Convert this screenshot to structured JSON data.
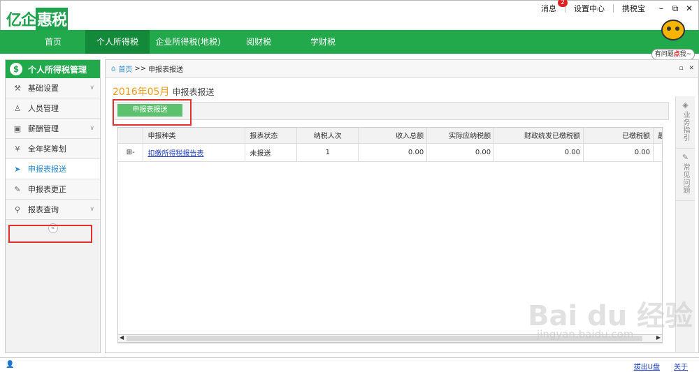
{
  "app": {
    "logo_prefix": "亿企",
    "logo_box": "惠税"
  },
  "topnav": {
    "messages": "消息",
    "messages_badge": "2",
    "settings": "设置中心",
    "taxbao": "携税宝"
  },
  "mainnav": {
    "tabs": [
      {
        "label": "首页"
      },
      {
        "label": "个人所得税"
      },
      {
        "label": "企业所得税(地税)"
      },
      {
        "label": "阅财税"
      },
      {
        "label": "学财税"
      }
    ]
  },
  "mascot": {
    "bubble_prefix": "有问题",
    "bubble_highlight": "点",
    "bubble_suffix": "我~"
  },
  "sidebar": {
    "title": "个人所得税管理",
    "items": [
      {
        "label": "基础设置",
        "icon": "wrench-icon",
        "expandable": true
      },
      {
        "label": "人员管理",
        "icon": "person-icon",
        "expandable": false
      },
      {
        "label": "薪酬管理",
        "icon": "salary-icon",
        "expandable": true
      },
      {
        "label": "全年奖筹划",
        "icon": "bonus-icon",
        "expandable": false
      },
      {
        "label": "申报表报送",
        "icon": "send-icon",
        "expandable": false,
        "active": true
      },
      {
        "label": "申报表更正",
        "icon": "edit-icon",
        "expandable": false
      },
      {
        "label": "报表查询",
        "icon": "search-icon",
        "expandable": true
      }
    ]
  },
  "breadcrumb": {
    "home": "首页",
    "separator": ">>",
    "current": "申报表报送"
  },
  "page": {
    "period": "2016年05月",
    "title": "申报表报送",
    "submit_button": "申报表报送"
  },
  "table": {
    "headers": [
      "申报种类",
      "报表状态",
      "纳税人次",
      "收入总额",
      "实际应纳税额",
      "财政统发已缴税额",
      "已缴税额",
      "最"
    ],
    "rows": [
      {
        "expander": "⊞-",
        "type": "扣缴所得税报告表",
        "status": "未报送",
        "count": "1",
        "income": "0.00",
        "tax_due": "0.00",
        "fiscal_paid": "0.00",
        "paid": "0.00"
      }
    ]
  },
  "rightbar": {
    "guide": "业务指引",
    "faq": "常见问题"
  },
  "statusbar": {
    "logout_udisk": "拔出U盘",
    "about": "关于"
  },
  "watermark": {
    "main": "Bai du 经验",
    "sub": "jingyan.baidu.com"
  }
}
